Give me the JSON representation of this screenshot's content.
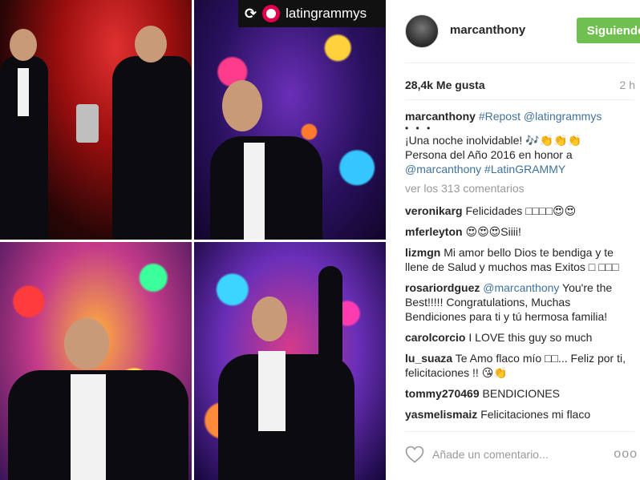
{
  "media": {
    "repost_badge": {
      "icon": "repost-icon",
      "logo": "grammy-logo",
      "account": "latingrammys"
    }
  },
  "header": {
    "username": "marcanthony",
    "follow_button": "Siguiendo",
    "follow_color": "#70c050"
  },
  "stats": {
    "likes": "28,4k Me gusta",
    "time": "2 h"
  },
  "caption": {
    "user": "marcanthony",
    "repost_tag": "#Repost",
    "mention": "@latingrammys",
    "dots": "• • •",
    "line1": "¡Una noche inolvidable! 🎶👏👏👏",
    "line2": "Persona del Año 2016 en honor a",
    "mention2": "@marcanthony",
    "hashtag": "#LatinGRAMMY"
  },
  "view_more": "ver los 313 comentarios",
  "comments": [
    {
      "user": "veronikarg",
      "text": "Felicidades □□□□😍😍"
    },
    {
      "user": "mferleyton",
      "text": "😍😍😍Siiii!"
    },
    {
      "user": "lizmgn",
      "text": "Mi amor bello Dios te bendiga y te llene de Salud y muchos mas Exitos □ □□□"
    },
    {
      "user": "rosariordguez",
      "mention": "@marcanthony",
      "text": "You're the Best!!!!! Congratulations, Muchas Bendiciones para ti y tú hermosa familia!"
    },
    {
      "user": "carolcorcio",
      "text": "I LOVE this guy so much"
    },
    {
      "user": "lu_suaza",
      "text": "Te Amo flaco mío □□... Feliz por ti, felicitaciones !! 😘👏"
    },
    {
      "user": "tommy270469",
      "text": "BENDICIONES"
    },
    {
      "user": "yasmelismaiz",
      "text": "Felicitaciones mi flaco"
    }
  ],
  "add_comment": {
    "placeholder": "Añade un comentario...",
    "more": "ooo"
  }
}
